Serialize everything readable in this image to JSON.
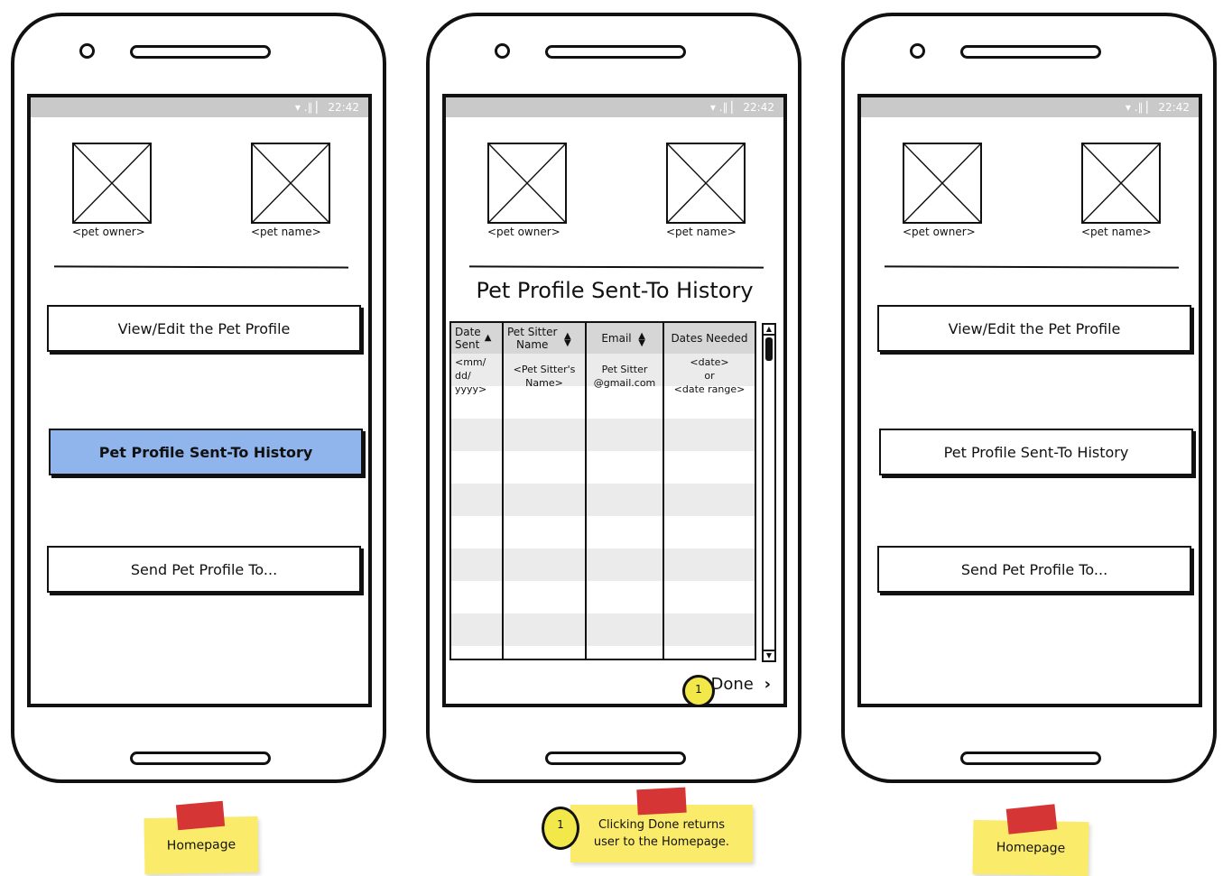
{
  "status_bar": {
    "time": "22:42",
    "icons": "▾ .∥ ▏"
  },
  "placeholders": {
    "pet_owner": "<pet owner>",
    "pet_name": "<pet name>"
  },
  "home": {
    "view_edit": "View/Edit the Pet Profile",
    "history": "Pet Profile Sent-To History",
    "send": "Send Pet Profile To..."
  },
  "history_screen": {
    "title": "Pet Profile Sent-To History",
    "columns": [
      {
        "label": "Date\nSent",
        "sort_icon": "▲"
      },
      {
        "label": "Pet Sitter\nName",
        "sort_icon": "▲▼"
      },
      {
        "label": "Email",
        "sort_icon": "▲▼"
      },
      {
        "label": "Dates Needed",
        "sort_icon": ""
      }
    ],
    "row": [
      "<mm/\ndd/\nyyyy>",
      "<Pet Sitter's\nName>",
      "Pet Sitter\n@gmail.com",
      "<date>\nor\n<date range>"
    ],
    "done": "Done",
    "done_icon": "chevron-right-icon",
    "marker": "1"
  },
  "notes": {
    "left": "Homepage",
    "middle_marker": "1",
    "middle": "Clicking Done returns user to the Homepage.",
    "right": "Homepage"
  },
  "colors": {
    "active_button": "#8fb5ec",
    "sticky_note": "#fbeb6a",
    "tape": "#d63535",
    "status_bar": "#c9c9c9"
  }
}
